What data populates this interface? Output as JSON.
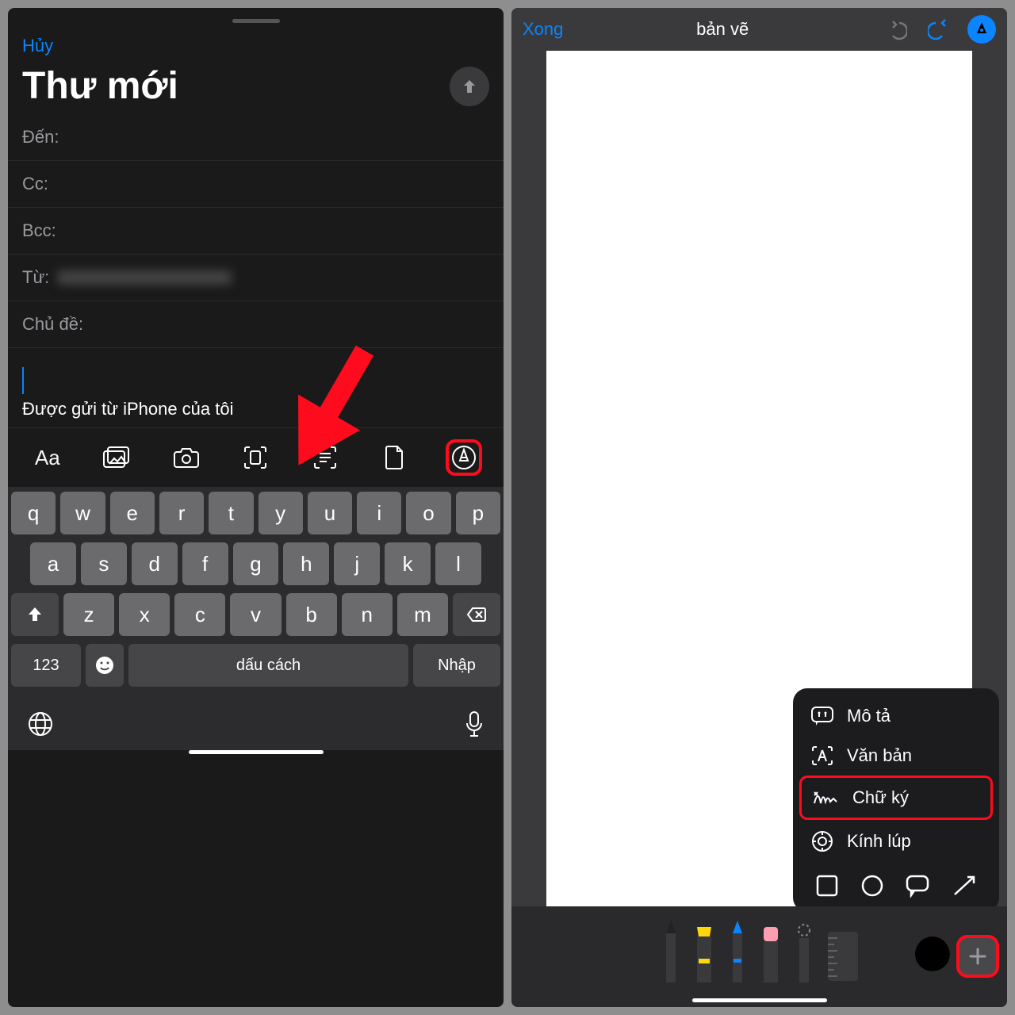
{
  "left": {
    "cancel": "Hủy",
    "title": "Thư mới",
    "fields": {
      "to": "Đến:",
      "cc": "Cc:",
      "bcc": "Bcc:",
      "from": "Từ:",
      "subject": "Chủ đề:"
    },
    "signature": "Được gửi từ iPhone của tôi",
    "toolbar": {
      "format": "Aa"
    },
    "keyboard": {
      "row1": [
        "q",
        "w",
        "e",
        "r",
        "t",
        "y",
        "u",
        "i",
        "o",
        "p"
      ],
      "row2": [
        "a",
        "s",
        "d",
        "f",
        "g",
        "h",
        "j",
        "k",
        "l"
      ],
      "row3": [
        "z",
        "x",
        "c",
        "v",
        "b",
        "n",
        "m"
      ],
      "numbers": "123",
      "space": "dấu cách",
      "enter": "Nhập"
    }
  },
  "right": {
    "done": "Xong",
    "title": "bản vẽ",
    "popup": {
      "describe": "Mô tả",
      "text": "Văn bản",
      "signature": "Chữ ký",
      "magnifier": "Kính lúp"
    }
  }
}
